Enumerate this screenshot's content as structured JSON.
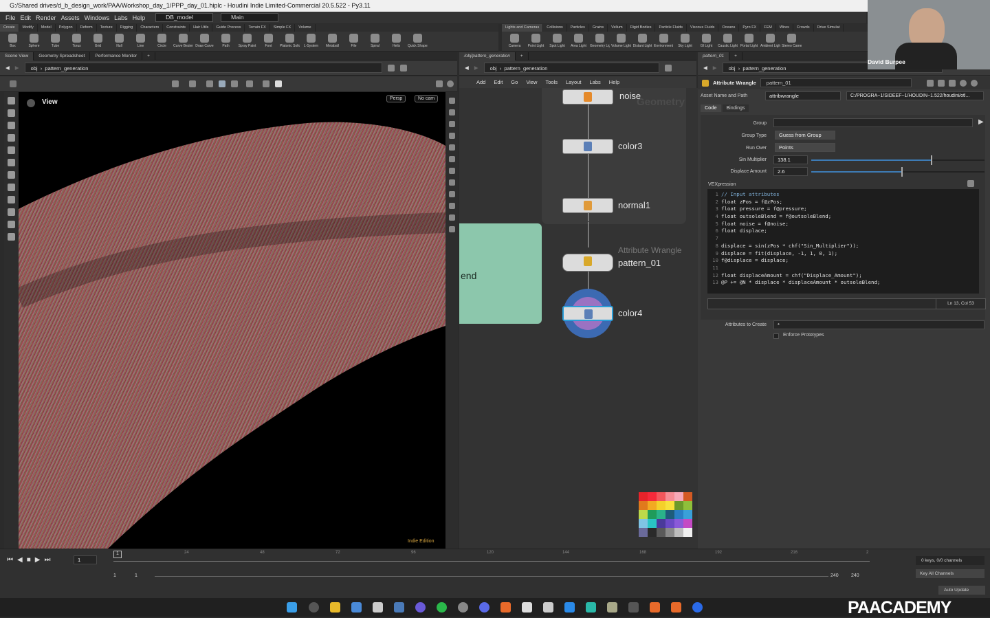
{
  "window": {
    "title": "G:/Shared drives/d_b_design_work/PAA/Workshop_day_1/PPP_day_01.hiplc - Houdini Indie Limited-Commercial 20.5.522 - Py3.11"
  },
  "menu": [
    "File",
    "Edit",
    "Render",
    "Assets",
    "Windows",
    "Labs",
    "Help"
  ],
  "desktop": {
    "name": "DB_model",
    "workspace": "Main"
  },
  "shelf_left": {
    "tabs": [
      "Create",
      "Modify",
      "Model",
      "Polygon",
      "Deform",
      "Texture",
      "Rigging",
      "Characters",
      "Constraints",
      "Hair Utils",
      "Guide Process",
      "Terrain FX",
      "Simple FX",
      "Volume"
    ],
    "tools": [
      "Box",
      "Sphere",
      "Tube",
      "Torus",
      "Grid",
      "Null",
      "Line",
      "Circle",
      "Curve Bezier",
      "Draw Curve",
      "Path",
      "Spray Paint",
      "Font",
      "Platonic Solids",
      "L-System",
      "Metaball",
      "File",
      "Spiral",
      "Helix",
      "Quick Shapes"
    ]
  },
  "shelf_right": {
    "tabs": [
      "Lights and Cameras",
      "Collisions",
      "Particles",
      "Grains",
      "Vellum",
      "Rigid Bodies",
      "Particle Fluids",
      "Viscous Fluids",
      "Oceans",
      "Pyro FX",
      "FEM",
      "Wires",
      "Crowds",
      "Drive Simulat"
    ],
    "tools": [
      "Camera",
      "Point Light",
      "Spot Light",
      "Area Light",
      "Geometry Light",
      "Volume Light",
      "Distant Light",
      "Environment Light",
      "Sky Light",
      "GI Light",
      "Caustic Light",
      "Portal Light",
      "Ambient Light",
      "Stereo Camera"
    ]
  },
  "left_pane": {
    "tabs": [
      "Scene View",
      "Geometry Spreadsheet",
      "Performance Monitor"
    ],
    "path_root": "obj",
    "path_node": "pattern_generation",
    "viewport_label": "View",
    "persp": "Persp",
    "cam": "No cam",
    "watermark": "Indie Edition"
  },
  "network": {
    "tab": "/obj/pattern_generation",
    "path_root": "obj",
    "path_node": "pattern_generation",
    "menu": [
      "Add",
      "Edit",
      "Go",
      "View",
      "Tools",
      "Layout",
      "Labs",
      "Help"
    ],
    "bg_label": "Geometry",
    "sticky_text": "end",
    "nodes": [
      {
        "name": "noise",
        "type": ""
      },
      {
        "name": "color3",
        "type": ""
      },
      {
        "name": "normal1",
        "type": ""
      },
      {
        "name": "pattern_01",
        "type": "Attribute Wrangle"
      },
      {
        "name": "color4",
        "type": ""
      }
    ],
    "swatches": [
      "#e8232a",
      "#f52a3a",
      "#f2565b",
      "#f58c94",
      "#f6a9b8",
      "#d45a23",
      "#e07a1c",
      "#f2a922",
      "#f4d02a",
      "#f7e13b",
      "#6a9a2a",
      "#8fbf3a",
      "#bcd94a",
      "#1f9b5a",
      "#2ab38a",
      "#1d5c7a",
      "#2a7fc4",
      "#3aa0d9",
      "#7fc4e4",
      "#2ac4c4",
      "#4a3a9a",
      "#6a4ac4",
      "#8a5ad9",
      "#c44ac4",
      "#6a6a9a",
      "#2a2a2a",
      "#5a5a5a",
      "#8a8a8a",
      "#bdbdbd",
      "#f0f0f0"
    ]
  },
  "params": {
    "tab": "pattern_01",
    "path_root": "obj",
    "path_node": "pattern_generation",
    "node_type": "Attribute Wrangle",
    "node_name": "pattern_01",
    "asset_label": "Asset Name and Path",
    "asset_name": "attribwrangle",
    "asset_path": "C:/PROGRA~1/SIDEEF~1/HOUDIN~1.522/houdini/otl...",
    "tabs": [
      "Code",
      "Bindings"
    ],
    "group_label": "Group",
    "group_value": "",
    "group_type_label": "Group Type",
    "group_type": "Guess from Group",
    "run_over_label": "Run Over",
    "run_over": "Points",
    "sin_label": "Sin Multiplier",
    "sin_value": "138.1",
    "sin_fraction": 0.69,
    "displace_label": "Displace Amount",
    "displace_value": "2.6",
    "displace_fraction": 0.52,
    "vex_label": "VEXpression",
    "code": [
      "// Input attributes",
      "float zPos = f@zPos;",
      "float pressure = f@pressure;",
      "float outsoleBlend = f@outsoleBlend;",
      "float noise = f@noise;",
      "float displace;",
      "",
      "displace = sin(zPos * chf(\"Sin_Multiplier\"));",
      "displace = fit(displace, -1, 1, 0, 1);",
      "f@displace = displace;",
      "",
      "float displaceAmount = chf(\"Displace_Amount\");",
      "@P += @N * displace * displaceAmount * outsoleBlend;"
    ],
    "cursor": "Ln 13, Col 53",
    "attrs_label": "Attributes to Create",
    "attrs_value": "*",
    "enforce_label": "Enforce Prototypes"
  },
  "timeline": {
    "frame": "1",
    "ticks": [
      "1",
      "24",
      "48",
      "72",
      "96",
      "120",
      "144",
      "168",
      "192",
      "216",
      "2"
    ],
    "start": "1",
    "start2": "1",
    "end": "240",
    "end2": "240",
    "keys": "0 keys, 0/0 channels",
    "key_all": "Key All Channels",
    "auto_update": "Auto Update"
  },
  "webcam": {
    "name": "David Burpee"
  },
  "brand": {
    "logo": "PAACADEMY"
  }
}
